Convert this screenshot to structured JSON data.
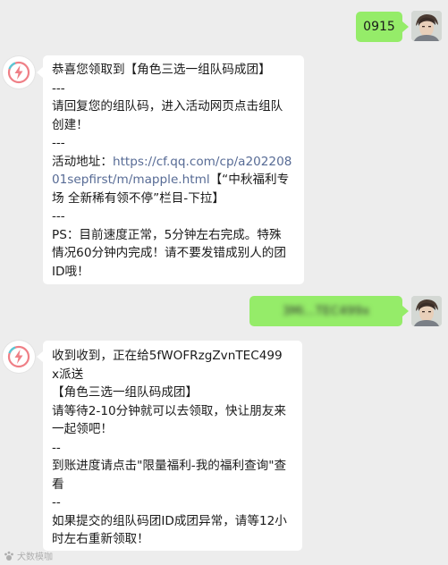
{
  "messages": {
    "m1": {
      "text": "0915"
    },
    "m2": {
      "l1": "恭喜您领取到【角色三选一组队码成团】",
      "l2": "---",
      "l3": "请回复您的组队码，进入活动网页点击组队",
      "l4": "创建！",
      "l5": "---",
      "l6_prefix": "活动地址：",
      "l6_link": "https://cf.qq.com/cp/a202208",
      "l7_link": "01sepfirst/m/mapple.html",
      "l7_suffix": "【“中秋福利专",
      "l8": "场 全新稀有领不停”栏目-下拉】",
      "l9": "---",
      "l10": "PS：目前速度正常，5分钟左右完成。特殊",
      "l11": "情况60分钟内完成！请不要发错成别人的团",
      "l12": "ID哦！"
    },
    "m3": {
      "text": "3Mi...TEC499x"
    },
    "m4": {
      "l1": "收到收到，正在给5fWOFRzgZvnTEC499",
      "l2": "x派送",
      "l3": "【角色三选一组队码成团】",
      "l4": "请等待2-10分钟就可以去领取，快让朋友来",
      "l5": "一起领吧！",
      "l6": "--",
      "l7": "到账进度请点击\"限量福利-我的福利查询\"查",
      "l8": "看",
      "l9": "--",
      "l10": "如果提交的组队码团ID成团异常，请等12小",
      "l11": "时左右重新领取！"
    }
  },
  "watermark": {
    "text": "犬数模咖"
  },
  "colors": {
    "bg": "#ededed",
    "out_bubble": "#95ec69",
    "in_bubble": "#ffffff",
    "link": "#576b95"
  }
}
